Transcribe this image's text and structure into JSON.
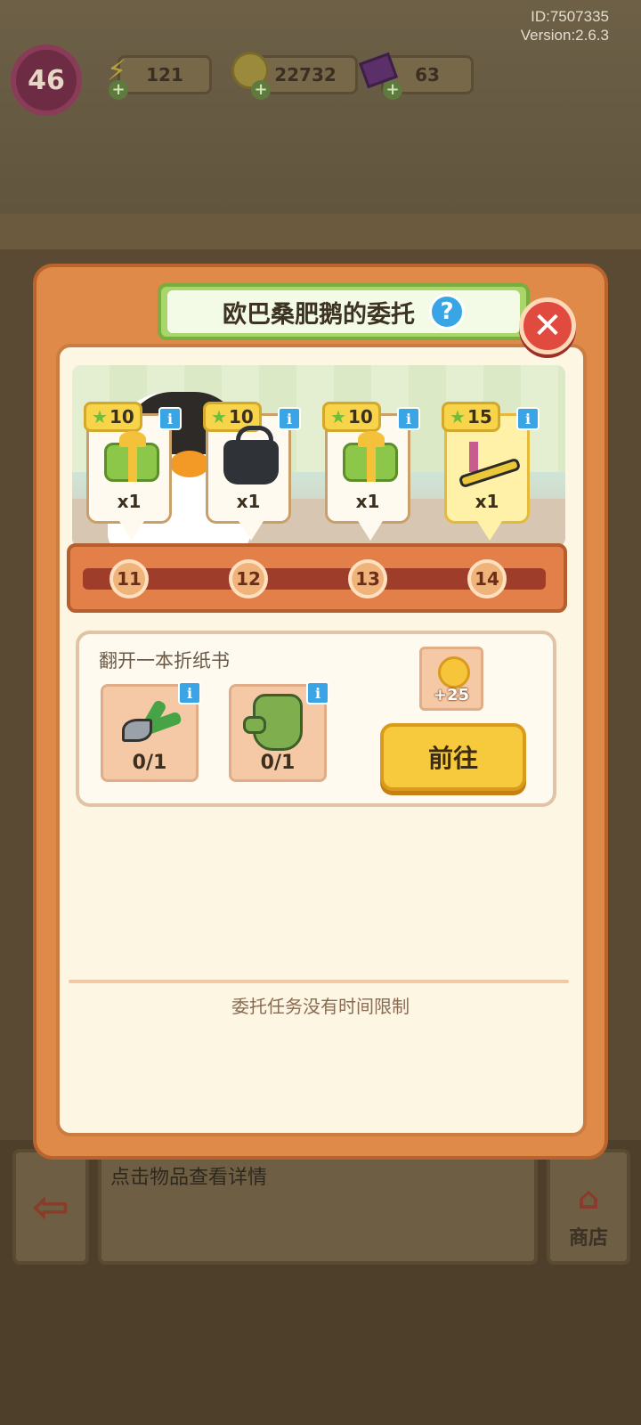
{
  "header": {
    "player_id": "ID:7507335",
    "version": "Version:2.6.3"
  },
  "hud": {
    "level": "46",
    "energy": "121",
    "coins": "22732",
    "gems": "63"
  },
  "background": {
    "hint_text": "点击物品查看详情",
    "shop_label": "商店"
  },
  "dialog": {
    "title": "欧巴桑肥鹅的委托",
    "help_symbol": "?",
    "close_symbol": "✕",
    "rewards": [
      {
        "stars": "10",
        "item": "gift-box",
        "qty": "x1"
      },
      {
        "stars": "10",
        "item": "black-bag",
        "qty": "x1"
      },
      {
        "stars": "10",
        "item": "gift-box",
        "qty": "x1"
      },
      {
        "stars": "15",
        "item": "treadmill",
        "qty": "x1",
        "highlight": true
      }
    ],
    "progress_nodes": [
      "11",
      "12",
      "13",
      "14"
    ],
    "task": {
      "title": "翻开一本折纸书",
      "items": [
        {
          "item": "pruning-shears",
          "progress": "0/1"
        },
        {
          "item": "gardening-glove",
          "progress": "0/1"
        }
      ],
      "coin_reward": "+25",
      "go_label": "前往"
    },
    "footer_note": "委托任务没有时间限制"
  },
  "colors": {
    "dialog_orange": "#e08a4a",
    "title_green": "#a8d66a",
    "info_blue": "#3aa5e5",
    "close_red": "#e04a3f",
    "go_yellow": "#f7c93c"
  }
}
